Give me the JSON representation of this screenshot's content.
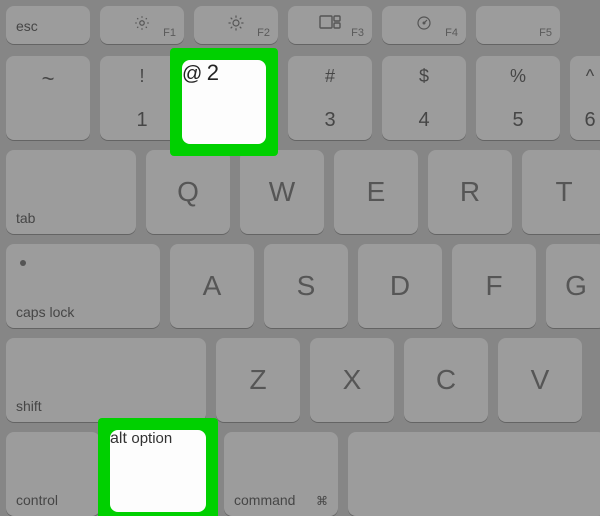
{
  "function_row": {
    "esc": "esc",
    "f1": "F1",
    "f2": "F2",
    "f3": "F3",
    "f4": "F4",
    "f5": "F5"
  },
  "number_row": {
    "tilde_top": "~",
    "one_top": "!",
    "one_bottom": "1",
    "two_top": "@",
    "two_bottom": "2",
    "three_top": "#",
    "three_bottom": "3",
    "four_top": "$",
    "four_bottom": "4",
    "five_top": "%",
    "five_bottom": "5",
    "six_top": "^",
    "six_bottom": "6"
  },
  "row_q": {
    "tab": "tab",
    "q": "Q",
    "w": "W",
    "e": "E",
    "r": "R",
    "t": "T"
  },
  "row_a": {
    "capslock": "caps lock",
    "a": "A",
    "s": "S",
    "d": "D",
    "f": "F",
    "g": "G"
  },
  "row_z": {
    "shift": "shift",
    "z": "Z",
    "x": "X",
    "c": "C",
    "v": "V"
  },
  "row_mod": {
    "control": "control",
    "option_small": "alt",
    "option_main": "option",
    "command_label": "command",
    "command_glyph": "⌘"
  },
  "highlight": {
    "color": "#00d000"
  }
}
